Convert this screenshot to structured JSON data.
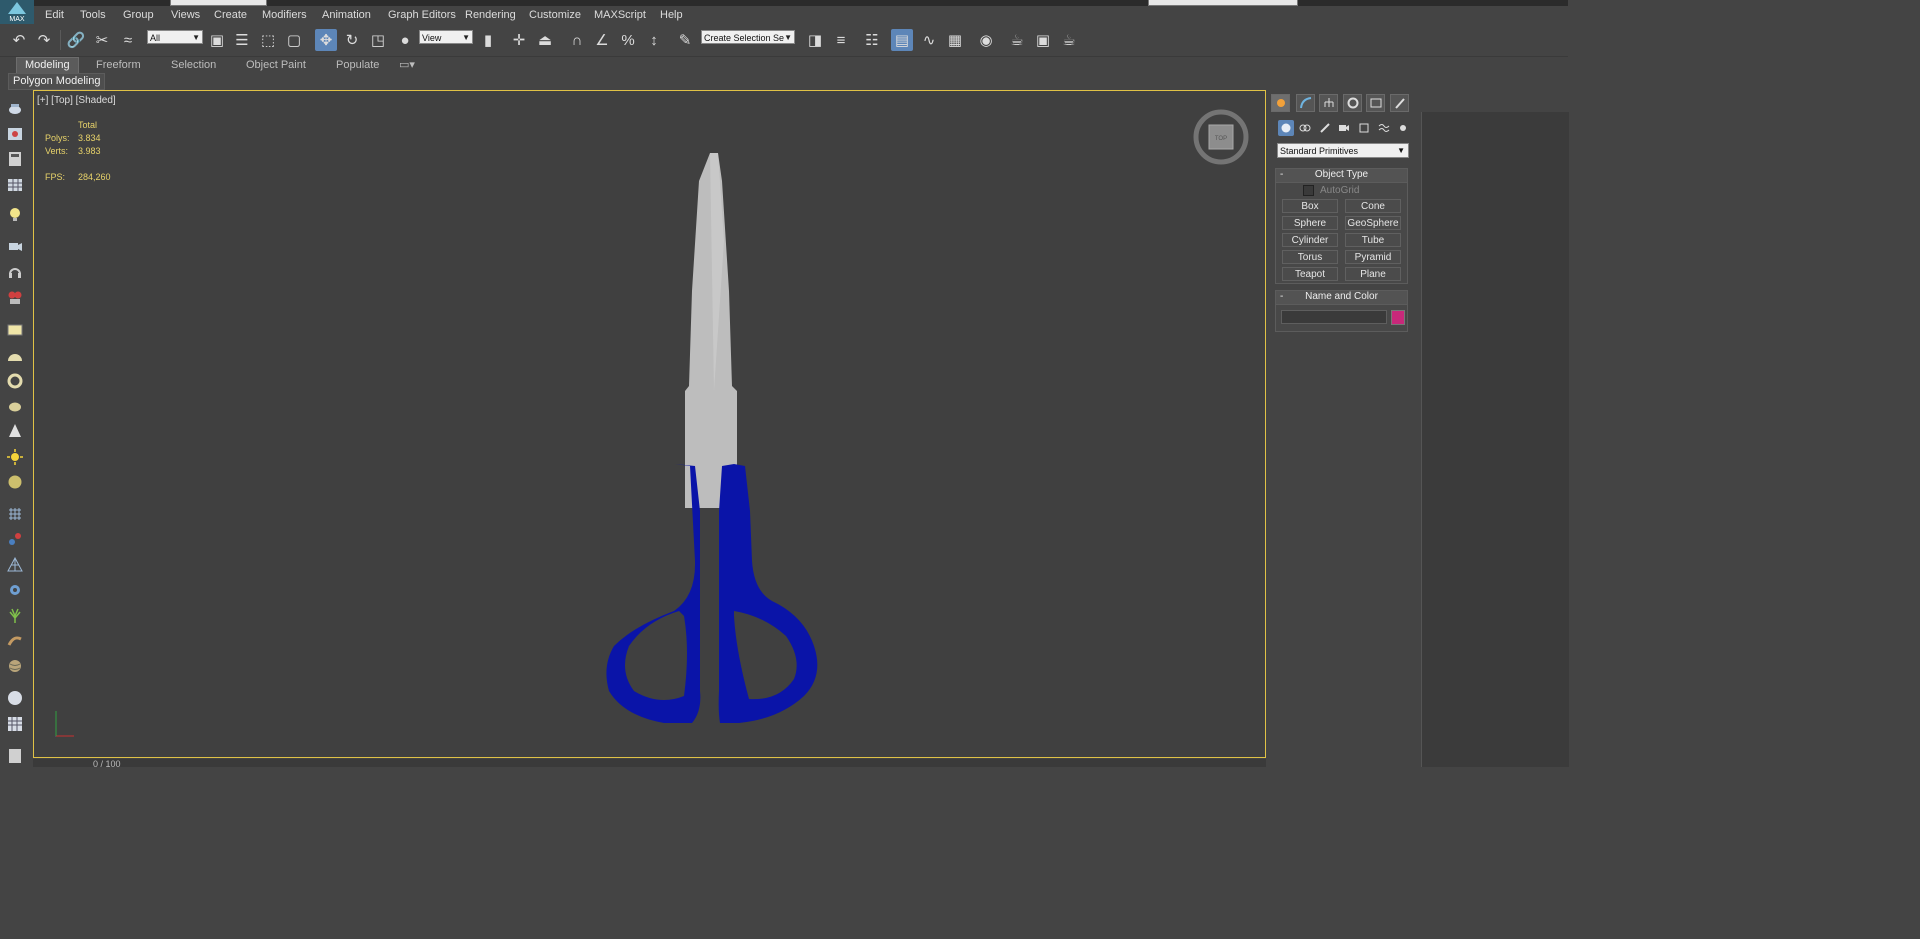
{
  "menu": [
    "Edit",
    "Tools",
    "Group",
    "Views",
    "Create",
    "Modifiers",
    "Animation",
    "Graph Editors",
    "Rendering",
    "Customize",
    "MAXScript",
    "Help"
  ],
  "logo_text": "MAX",
  "toolbar": {
    "selection_filter": "All",
    "ref_coord": "View",
    "named_selection": "Create Selection Se"
  },
  "ribbon": {
    "tabs": [
      "Modeling",
      "Freeform",
      "Selection",
      "Object Paint",
      "Populate"
    ],
    "active_tab": "Modeling",
    "sub_label": "Polygon Modeling"
  },
  "viewport": {
    "label": "[+] [Top] [Shaded]",
    "stats": {
      "total_label": "Total",
      "polys_label": "Polys:",
      "polys_value": "3.834",
      "verts_label": "Verts:",
      "verts_value": "3.983",
      "fps_label": "FPS:",
      "fps_value": "284,260"
    },
    "viewcube_label": "TOP",
    "status_text": "0 / 100"
  },
  "command_panel": {
    "category": "Standard Primitives",
    "object_type": {
      "header": "Object Type",
      "autogrid_label": "AutoGrid",
      "autogrid_checked": false,
      "buttons": [
        "Box",
        "Cone",
        "Sphere",
        "GeoSphere",
        "Cylinder",
        "Tube",
        "Torus",
        "Pyramid",
        "Teapot",
        "Plane"
      ]
    },
    "name_color": {
      "header": "Name and Color",
      "name_value": "",
      "color": "#c8287a"
    }
  },
  "colors": {
    "viewport_bg": "#404040",
    "active_border": "#e0c246",
    "handle_blue": "#0a14a8",
    "blade_gray": "#bdbdbd",
    "stats_yellow": "#e8d36a"
  }
}
